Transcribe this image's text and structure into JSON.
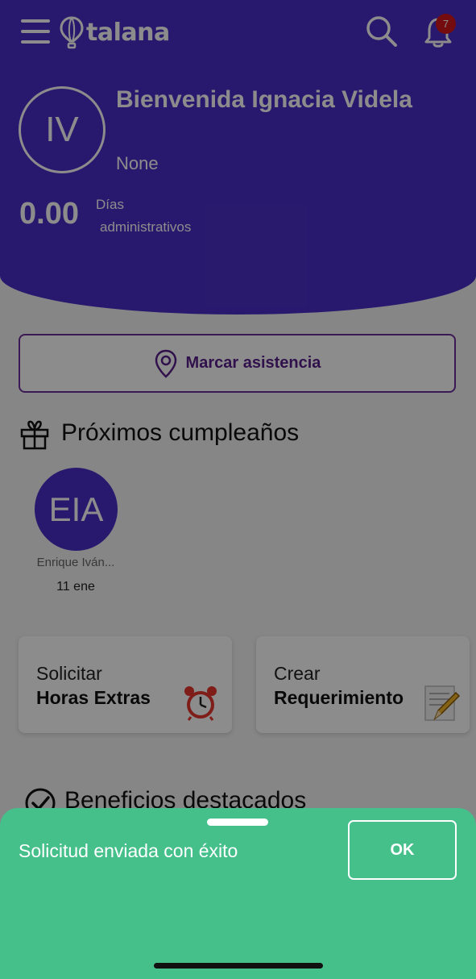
{
  "header": {
    "brand": "talana",
    "notifications_count": "7",
    "avatar_initials": "IV",
    "welcome_text": "Bienvenida Ignacia Videla",
    "role": "None",
    "days_value": "0.00",
    "days_label_1": "Días",
    "days_label_2": "administrativos"
  },
  "attendance": {
    "label": "Marcar asistencia"
  },
  "birthdays": {
    "title": "Próximos cumpleaños",
    "items": [
      {
        "initials": "EIA",
        "name": "Enrique Iván...",
        "date": "11 ene"
      }
    ]
  },
  "cards": [
    {
      "line1": "Solicitar",
      "line2": "Horas Extras",
      "icon": "alarm-clock-icon"
    },
    {
      "line1": "Crear",
      "line2": "Requerimiento",
      "icon": "memo-icon"
    }
  ],
  "benefits": {
    "title": "Beneficios destacados"
  },
  "toast": {
    "message": "Solicitud enviada con éxito",
    "ok_label": "OK"
  },
  "colors": {
    "brand": "#4a2fc9",
    "success": "#45c08b",
    "accent": "#5a1f8a",
    "badge": "#d4141c"
  }
}
